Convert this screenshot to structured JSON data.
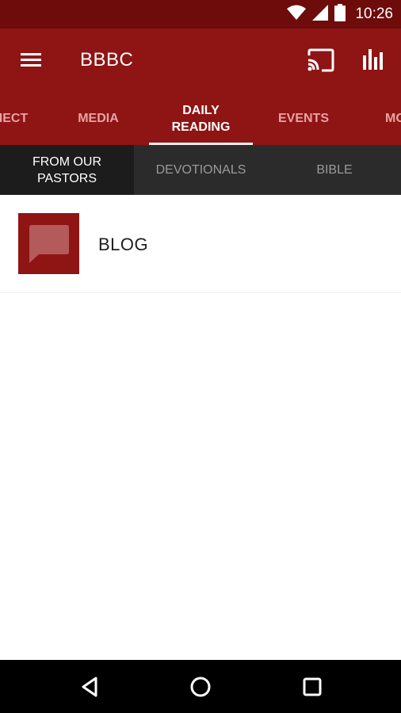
{
  "status_bar": {
    "time": "10:26",
    "icons": [
      "wifi-icon",
      "signal-icon",
      "battery-icon"
    ]
  },
  "app_bar": {
    "title": "BBBC",
    "icons": [
      "menu-icon",
      "cast-icon",
      "bar-chart-icon"
    ]
  },
  "tabs": [
    {
      "label": "IECT",
      "active": false
    },
    {
      "label": "MEDIA",
      "active": false
    },
    {
      "label": "DAILY\nREADING",
      "active": true
    },
    {
      "label": "EVENTS",
      "active": false
    },
    {
      "label": "MO",
      "active": false
    }
  ],
  "sub_tabs": [
    {
      "label": "FROM OUR\nPASTORS",
      "active": true
    },
    {
      "label": "DEVOTIONALS",
      "active": false
    },
    {
      "label": "BIBLE",
      "active": false
    }
  ],
  "list": [
    {
      "label": "BLOG",
      "icon": "chat-bubble-icon"
    }
  ],
  "nav_bar": {
    "icons": [
      "back-icon",
      "home-icon",
      "recents-icon"
    ]
  },
  "colors": {
    "status_bar": "#6e0b0b",
    "primary": "#8f1414",
    "sub_tab_bg": "#2b2b2b",
    "sub_tab_active_bg": "#1c1c1c",
    "nav_bar": "#000000"
  }
}
